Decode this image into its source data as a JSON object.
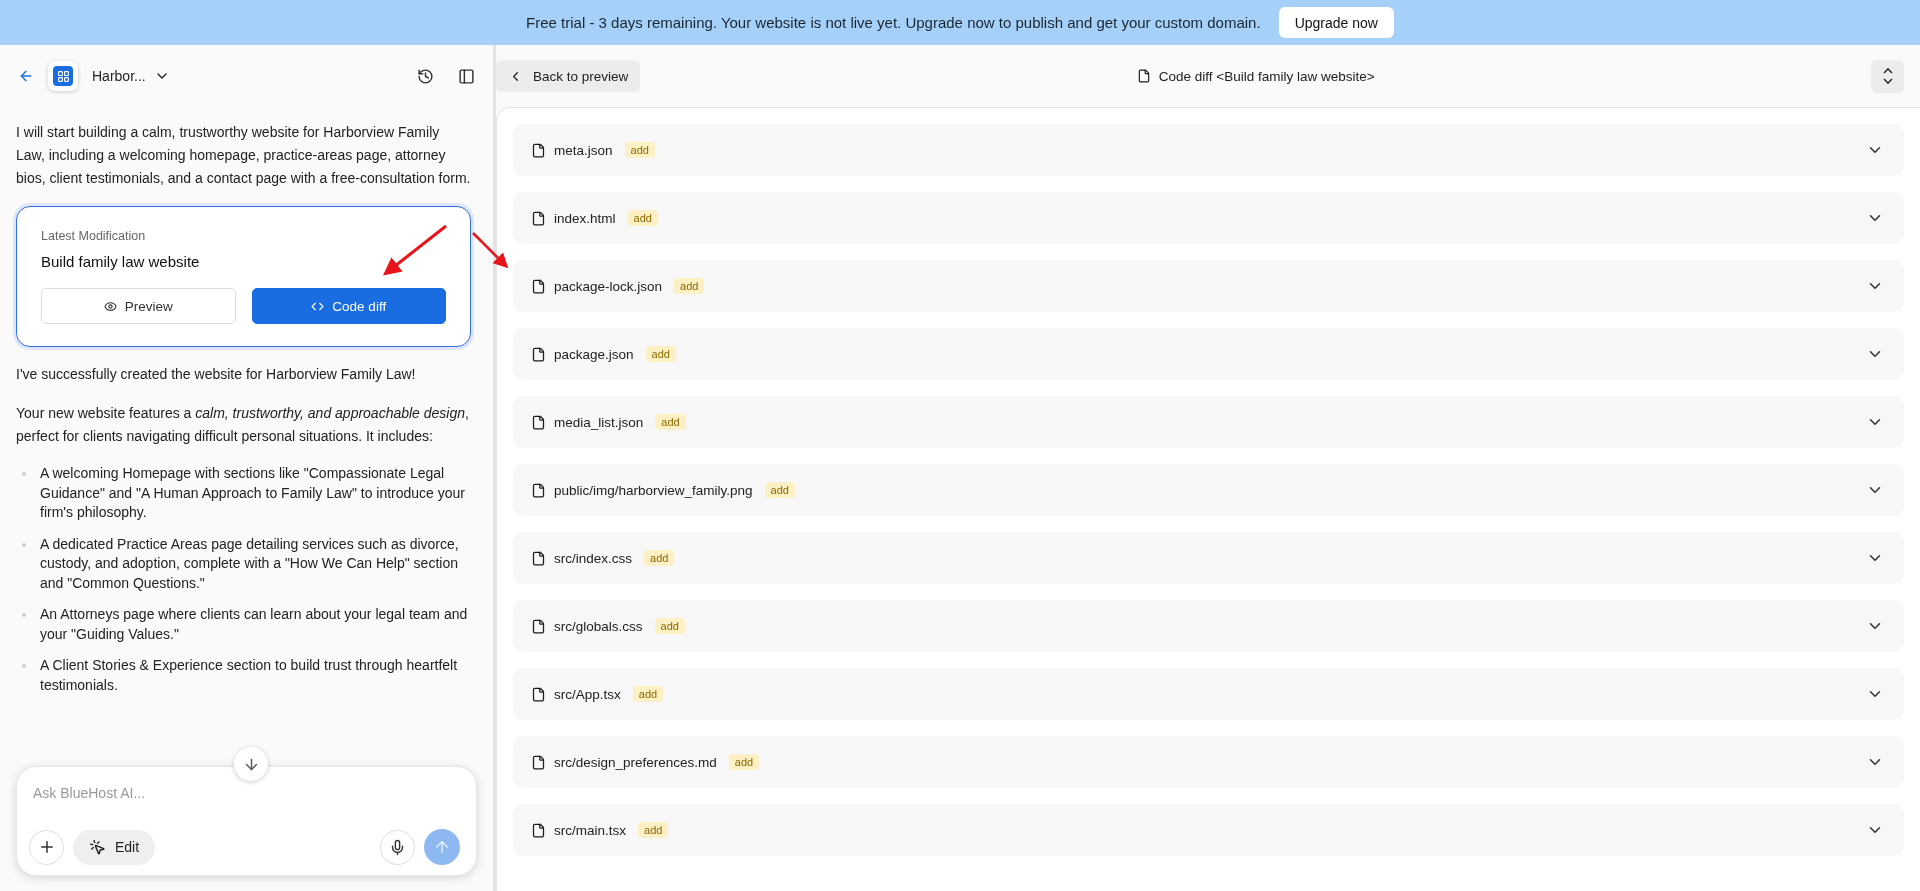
{
  "banner": {
    "message": "Free trial - 3 days remaining. Your website is not live yet. Upgrade now to publish and get your custom domain.",
    "button": "Upgrade now"
  },
  "sidebar": {
    "project": "Harbor...",
    "messages": [
      {
        "kind": "text",
        "text": "I will start building a calm, trustworthy website for Harborview Family Law, including a welcoming homepage, practice-areas page, attorney bios, client testimonials, and a contact page with a free-consultation form."
      },
      {
        "kind": "card",
        "label": "Latest Modification",
        "title": "Build family law website",
        "buttons": [
          {
            "label": "Preview",
            "selected": false
          },
          {
            "label": "Code diff",
            "selected": true
          }
        ]
      },
      {
        "kind": "text",
        "text": "I've successfully created the website for Harborview Family Law!"
      },
      {
        "kind": "text",
        "text": "Your new website features a *calm, trustworthy, and approachable design*, perfect for clients navigating difficult personal situations. It includes:"
      },
      {
        "kind": "list",
        "items": [
          "A welcoming Homepage with sections like \"Compassionate Legal Guidance\" and \"A Human Approach to Family Law\" to introduce your firm's philosophy.",
          "A dedicated Practice Areas page detailing services such as divorce, custody, and adoption, complete with a \"How We Can Help\" section and \"Common Questions.\"",
          "An Attorneys page where clients can learn about your legal team and your \"Guiding Values.\"",
          "A Client Stories & Experience section to build trust through heartfelt testimonials."
        ]
      }
    ],
    "input": {
      "placeholder": "Ask BlueHost AI...",
      "edit_button": "Edit"
    }
  },
  "diff": {
    "back_button": "Back to preview",
    "title": "Code diff <Build family law website>",
    "files": [
      {
        "name": "meta.json",
        "status": "add",
        "expanded": false
      },
      {
        "name": "index.html",
        "status": "add",
        "expanded": false
      },
      {
        "name": "package-lock.json",
        "status": "add",
        "expanded": false
      },
      {
        "name": "package.json",
        "status": "add",
        "expanded": false
      },
      {
        "name": "media_list.json",
        "status": "add",
        "expanded": false
      },
      {
        "name": "public/img/harborview_family.png",
        "status": "add",
        "expanded": false
      },
      {
        "name": "src/index.css",
        "status": "add",
        "expanded": false
      },
      {
        "name": "src/globals.css",
        "status": "add",
        "expanded": false
      },
      {
        "name": "src/App.tsx",
        "status": "add",
        "expanded": false
      },
      {
        "name": "src/design_preferences.md",
        "status": "add",
        "expanded": false
      },
      {
        "name": "src/main.tsx",
        "status": "add",
        "expanded": false
      }
    ]
  }
}
